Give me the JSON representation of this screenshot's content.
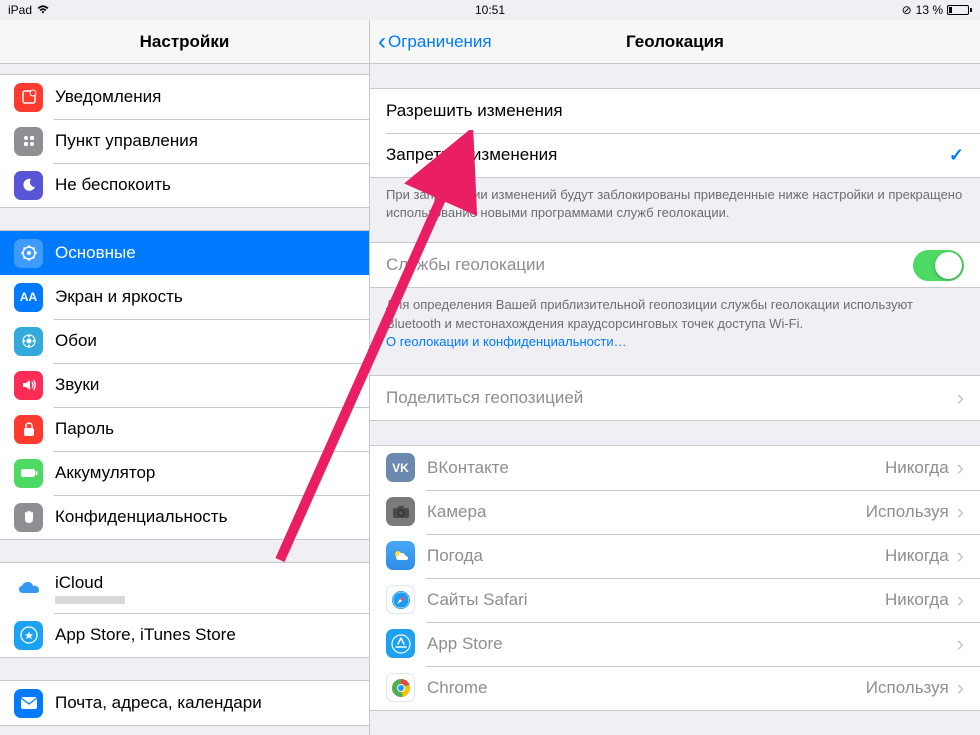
{
  "status": {
    "device": "iPad",
    "time": "10:51",
    "battery_text": "13 %",
    "lock": "⟳"
  },
  "sidebar": {
    "title": "Настройки",
    "group1": {
      "notifications": "Уведомления",
      "control_center": "Пункт управления",
      "dnd": "Не беспокоить"
    },
    "group2": {
      "general": "Основные",
      "display": "Экран и яркость",
      "wallpaper": "Обои",
      "sounds": "Звуки",
      "passcode": "Пароль",
      "battery": "Аккумулятор",
      "privacy": "Конфиденциальность"
    },
    "group3": {
      "icloud": "iCloud",
      "appstore": "App Store, iTunes Store"
    },
    "group4": {
      "mail": "Почта, адреса, календари"
    }
  },
  "detail": {
    "back": "Ограничения",
    "title": "Геолокация",
    "allow_changes": "Разрешить изменения",
    "disallow_changes": "Запретить изменения",
    "footer1": "При запрещении изменений будут заблокированы приведенные ниже настройки и прекращено использование новыми программами служб геолокации.",
    "location_services": "Службы геолокации",
    "footer2_a": "Для определения Вашей приблизительной геопозиции службы геолокации используют Bluetooth и местонахождения краудсорсинговых точек доступа Wi-Fi.",
    "footer2_link": "О геолокации и конфиденциальности…",
    "share_location": "Поделиться геопозицией",
    "apps": {
      "vk": {
        "name": "ВКонтакте",
        "status": "Никогда"
      },
      "camera": {
        "name": "Камера",
        "status": "Используя"
      },
      "weather": {
        "name": "Погода",
        "status": "Никогда"
      },
      "safari": {
        "name": "Сайты Safari",
        "status": "Никогда"
      },
      "appstore": {
        "name": "App Store",
        "status": ""
      },
      "chrome": {
        "name": "Chrome",
        "status": "Используя"
      }
    }
  },
  "colors": {
    "blue": "#007aff",
    "green": "#4cd964"
  }
}
